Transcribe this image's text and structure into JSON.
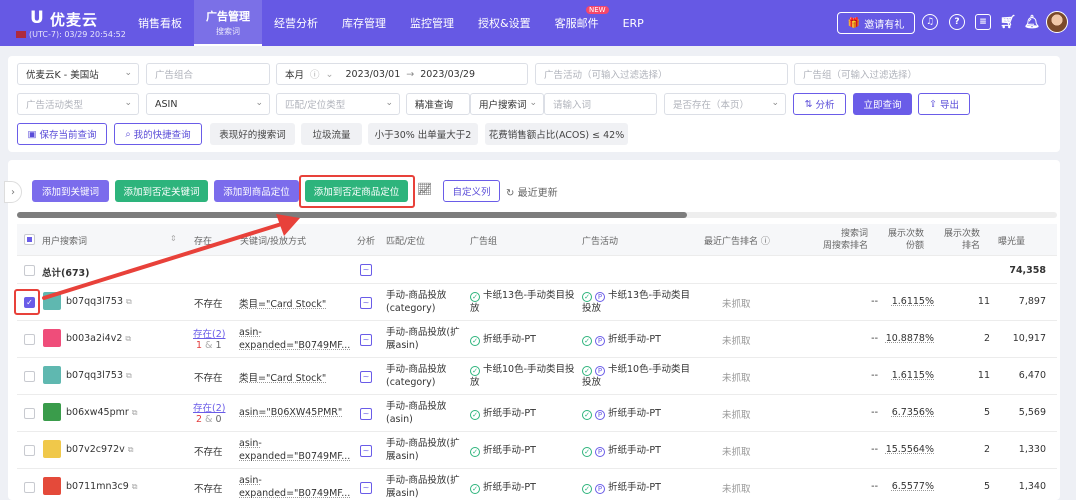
{
  "nav": {
    "logo_mark": "U",
    "logo_name": "优麦云",
    "logo_sub": "(UTC-7): 03/29 20:54:52",
    "items": [
      {
        "label": "销售看板",
        "sub": "",
        "badge": ""
      },
      {
        "label": "广告管理",
        "sub": "搜索词",
        "badge": ""
      },
      {
        "label": "经营分析",
        "sub": "",
        "badge": ""
      },
      {
        "label": "库存管理",
        "sub": "",
        "badge": ""
      },
      {
        "label": "监控管理",
        "sub": "",
        "badge": ""
      },
      {
        "label": "授权&设置",
        "sub": "",
        "badge": ""
      },
      {
        "label": "客服邮件",
        "sub": "",
        "badge": "NEW"
      },
      {
        "label": "ERP",
        "sub": "",
        "badge": ""
      }
    ],
    "invite_label": "邀请有礼",
    "icons": [
      "headset-icon",
      "help-icon",
      "message-icon",
      "cart-icon",
      "bell-icon"
    ]
  },
  "filters": {
    "store": "优麦云K - 美国站",
    "ad_group_combo_ph": "广告组合",
    "period": "本月",
    "date_start": "2023/03/01",
    "date_arrow": "→",
    "date_end": "2023/03/29",
    "campaign_ph": "广告活动（可输入过滤选择）",
    "ad_group_ph": "广告组（可输入过滤选择）",
    "campaign_type_ph": "广告活动类型",
    "asin": "ASIN",
    "match_type_ph": "匹配/定位类型",
    "exact_query": "精准查询",
    "search_term_select": "用户搜索词",
    "input_ph": "请输入词",
    "exists_ph": "是否存在（本页）",
    "analyze": "分析",
    "query": "立即查询",
    "export": "导出",
    "save_query": "保存当前查询",
    "my_quick": "我的快捷查询",
    "chips": [
      "表现好的搜索词",
      "垃圾流量",
      "小于30% 出单量大于2",
      "花费销售额占比(ACOS) ≤ 42%"
    ]
  },
  "actions": {
    "add_keyword": "添加到关键词",
    "add_negative_keyword": "添加到否定关键词",
    "add_product_target": "添加到商品定位",
    "add_negative_product_target": "添加到否定商品定位",
    "custom_columns": "自定义列",
    "recent_update": "最近更新"
  },
  "table": {
    "headers": {
      "search_term": "用户搜索词",
      "exists": "存在",
      "keyword": "关键词/投放方式",
      "analysis": "分析",
      "match": "匹配/定位",
      "ad_group": "广告组",
      "campaign": "广告活动",
      "rank": "最近广告排名",
      "weekly_rank_1": "搜索词",
      "weekly_rank_2": "周搜索排名",
      "imp_share_1": "展示次数",
      "imp_share_2": "份额",
      "imp_rank_1": "展示次数",
      "imp_rank_2": "排名",
      "impressions": "曝光量"
    },
    "total": {
      "label": "总计(673)",
      "impressions": "74,358"
    },
    "rows": [
      {
        "term": "b07qq3l753",
        "exists": "不存在",
        "exists_counts": [
          "",
          ""
        ],
        "keyword": "类目=\"Card Stock\"",
        "match": "手动-商品投放(category)",
        "ad_group": "卡纸13色-手动类目投放",
        "campaign": "卡纸13色-手动类目投放",
        "rank": "未抓取",
        "weekly": "--",
        "share": "1.6115%",
        "imp_rank": "11",
        "impressions": "7,897",
        "checked": true,
        "thumb": "#5fb8b0"
      },
      {
        "term": "b003a2i4v2",
        "exists": "存在(2)",
        "exists_counts": [
          "1",
          "1"
        ],
        "keyword": "asin-expanded=\"B0749MF...",
        "match": "手动-商品投放(扩展asin)",
        "ad_group": "折纸手动-PT",
        "campaign": "折纸手动-PT",
        "rank": "未抓取",
        "weekly": "--",
        "share": "10.8878%",
        "imp_rank": "2",
        "impressions": "10,917",
        "checked": false,
        "thumb": "#ef4d7a"
      },
      {
        "term": "b07qq3l753",
        "exists": "不存在",
        "exists_counts": [
          "",
          ""
        ],
        "keyword": "类目=\"Card Stock\"",
        "match": "手动-商品投放(category)",
        "ad_group": "卡纸10色-手动类目投放",
        "campaign": "卡纸10色-手动类目投放",
        "rank": "未抓取",
        "weekly": "--",
        "share": "1.6115%",
        "imp_rank": "11",
        "impressions": "6,470",
        "checked": false,
        "thumb": "#5fb8b0"
      },
      {
        "term": "b06xw45pmr",
        "exists": "存在(2)",
        "exists_counts": [
          "2",
          "0"
        ],
        "keyword": "asin=\"B06XW45PMR\"",
        "match": "手动-商品投放(asin)",
        "ad_group": "折纸手动-PT",
        "campaign": "折纸手动-PT",
        "rank": "未抓取",
        "weekly": "--",
        "share": "6.7356%",
        "imp_rank": "5",
        "impressions": "5,569",
        "checked": false,
        "thumb": "#3a9c4b"
      },
      {
        "term": "b07v2c972v",
        "exists": "不存在",
        "exists_counts": [
          "",
          ""
        ],
        "keyword": "asin-expanded=\"B0749MF...",
        "match": "手动-商品投放(扩展asin)",
        "ad_group": "折纸手动-PT",
        "campaign": "折纸手动-PT",
        "rank": "未抓取",
        "weekly": "--",
        "share": "15.5564%",
        "imp_rank": "2",
        "impressions": "1,330",
        "checked": false,
        "thumb": "#f0c84a"
      },
      {
        "term": "b0711mn3c9",
        "exists": "不存在",
        "exists_counts": [
          "",
          ""
        ],
        "keyword": "asin-expanded=\"B0749MF...",
        "match": "手动-商品投放(扩展asin)",
        "ad_group": "折纸手动-PT",
        "campaign": "折纸手动-PT",
        "rank": "未抓取",
        "weekly": "--",
        "share": "6.5577%",
        "imp_rank": "5",
        "impressions": "1,340",
        "checked": false,
        "thumb": "#e44a3a"
      }
    ]
  },
  "colors": {
    "primary": "#6a5ce8",
    "nav_bg": "#6659e4",
    "green": "#2db47c",
    "annotation_red": "#e8413a"
  }
}
